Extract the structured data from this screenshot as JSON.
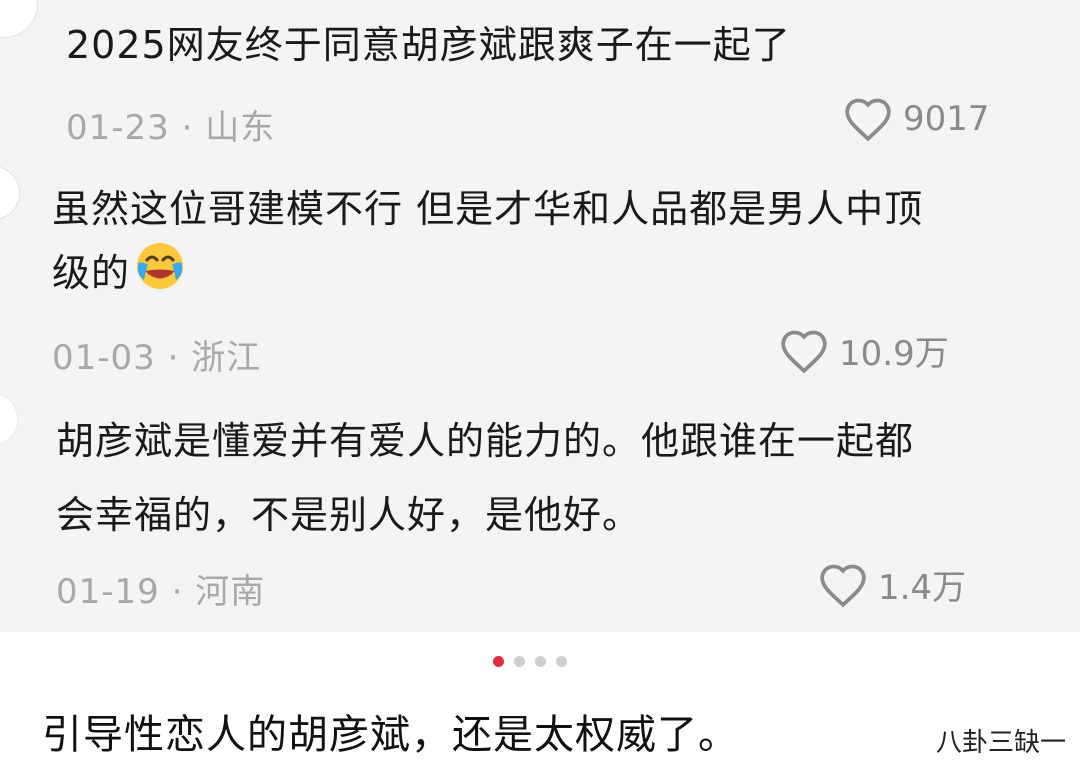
{
  "comments": [
    {
      "lines": [
        "2025网友终于同意胡彦斌跟爽子在一起了"
      ],
      "date": "01-23",
      "location": "山东",
      "likes": "9017"
    },
    {
      "lines": [
        "虽然这位哥建模不行 但是才华和人品都是男人中顶",
        "级的"
      ],
      "emoji": "laugh-cry-emoji",
      "date": "01-03",
      "location": "浙江",
      "likes": "10.9万"
    },
    {
      "lines": [
        "胡彦斌是懂爱并有爱人的能力的。他跟谁在一起都",
        "会幸福的，不是别人好，是他好。"
      ],
      "date": "01-19",
      "location": "河南",
      "likes": "1.4万"
    }
  ],
  "meta_separator": "·",
  "carousel": {
    "count": 4,
    "active_index": 0
  },
  "caption": "引导性恋人的胡彦斌，还是太权威了。",
  "watermark": "八卦三缺一",
  "colors": {
    "accent": "#e02e3c",
    "text": "#1a1a1a",
    "meta": "#a8a8a8",
    "icon": "#8a8a8a"
  },
  "icons": {
    "like": "heart-outline-icon"
  }
}
